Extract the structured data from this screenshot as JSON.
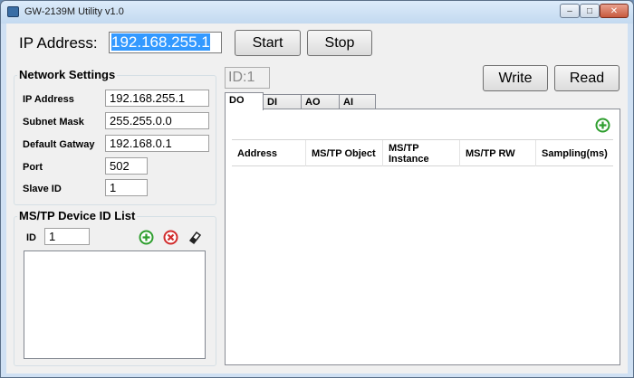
{
  "window": {
    "title": "GW-2139M Utility v1.0"
  },
  "ipbar": {
    "label": "IP Address:",
    "ip_value": "192.168.255.1",
    "start_label": "Start",
    "stop_label": "Stop"
  },
  "network": {
    "title": "Network Settings",
    "ip_label": "IP Address",
    "ip_value": "192.168.255.1",
    "subnet_label": "Subnet Mask",
    "subnet_value": "255.255.0.0",
    "gateway_label": "Default Gatway",
    "gateway_value": "192.168.0.1",
    "port_label": "Port",
    "port_value": "502",
    "slave_label": "Slave ID",
    "slave_value": "1"
  },
  "device_list": {
    "title": "MS/TP Device ID List",
    "id_label": "ID",
    "id_value": "1",
    "items": []
  },
  "right": {
    "id_display": "ID:1",
    "write_label": "Write",
    "read_label": "Read",
    "tabs": [
      "DO",
      "DI",
      "AO",
      "AI"
    ],
    "active_tab": "DO",
    "columns": [
      "Address",
      "MS/TP Object",
      "MS/TP Instance",
      "MS/TP RW",
      "Sampling(ms)"
    ],
    "rows": []
  },
  "icons": {
    "add": "add-circle-icon",
    "remove": "remove-circle-icon",
    "edit": "eraser-icon",
    "add_color": "#2e9e2e",
    "remove_color": "#d12c2c"
  }
}
